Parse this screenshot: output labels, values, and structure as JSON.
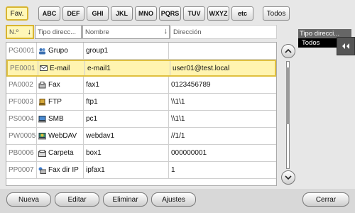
{
  "tabs": [
    {
      "label": "Fav."
    },
    {
      "label": "ABC"
    },
    {
      "label": "DEF"
    },
    {
      "label": "GHI"
    },
    {
      "label": "JKL"
    },
    {
      "label": "MNO"
    },
    {
      "label": "PQRS"
    },
    {
      "label": "TUV"
    },
    {
      "label": "WXYZ"
    },
    {
      "label": "etc"
    },
    {
      "label": "Todos"
    }
  ],
  "columns": {
    "number": "N.º",
    "type": "Tipo direcc...",
    "name": "Nombre",
    "address": "Dirección",
    "sort_arrow": "↓"
  },
  "rows": [
    {
      "id": "PG0001",
      "type": "Grupo",
      "name": "group1",
      "address": "",
      "icon": "group-icon"
    },
    {
      "id": "PE0001",
      "type": "E-mail",
      "name": "e-mail1",
      "address": "user01@test.local",
      "icon": "email-icon"
    },
    {
      "id": "PA0002",
      "type": "Fax",
      "name": "fax1",
      "address": "0123456789",
      "icon": "fax-icon"
    },
    {
      "id": "PF0003",
      "type": "FTP",
      "name": "ftp1",
      "address": "\\\\1\\1",
      "icon": "ftp-icon"
    },
    {
      "id": "PS0004",
      "type": "SMB",
      "name": "pc1",
      "address": "\\\\1\\1",
      "icon": "smb-icon"
    },
    {
      "id": "PW0005",
      "type": "WebDAV",
      "name": "webdav1",
      "address": "//1/1",
      "icon": "webdav-icon"
    },
    {
      "id": "PB0006",
      "type": "Carpeta",
      "name": "box1",
      "address": "000000001",
      "icon": "folder-box-icon"
    },
    {
      "id": "PP0007",
      "type": "Fax dir IP",
      "name": "ipfax1",
      "address": "1",
      "icon": "ip-fax-icon"
    }
  ],
  "filter_panel": {
    "title": "Tipo direcci...",
    "value": "Todos"
  },
  "buttons": {
    "new": "Nueva",
    "edit": "Editar",
    "delete": "Eliminar",
    "settings": "Ajustes",
    "close": "Cerrar"
  },
  "colors": {
    "selection": "#fff4b0",
    "selection_border": "#e0c040"
  }
}
